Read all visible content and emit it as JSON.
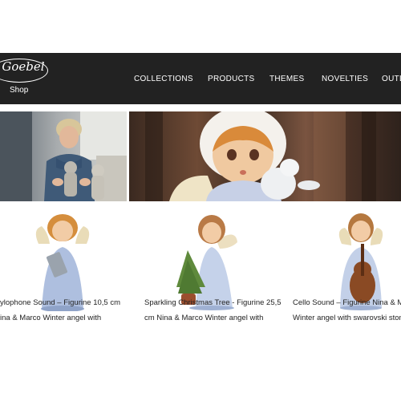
{
  "header": {
    "logo_text": "Goebel",
    "shop_label": "Shop",
    "nav": [
      {
        "label": "COLLECTIONS"
      },
      {
        "label": "PRODUCTS"
      },
      {
        "label": "THEMES"
      },
      {
        "label": "NOVELTIES"
      },
      {
        "label": "OUTL"
      }
    ]
  },
  "banner": {
    "left_scene": "artisan-painting-figurines",
    "right_scene": "angel-figurine-with-bunny"
  },
  "products": [
    {
      "caption_line1": "ylophone Sound – Figurine 10,5 cm",
      "caption_line2": "ina & Marco Winter angel with"
    },
    {
      "caption_line1": "Sparkling Christmas Tree - Figurine 25,5",
      "caption_line2": "cm Nina & Marco Winter angel with"
    },
    {
      "caption_line1": "Cello Sound – Figurine Nina & Ma",
      "caption_line2": "Winter angel with swarovski stone"
    }
  ],
  "colors": {
    "header_bg": "#222222",
    "header_text": "#ffffff",
    "page_bg": "#ffffff"
  }
}
